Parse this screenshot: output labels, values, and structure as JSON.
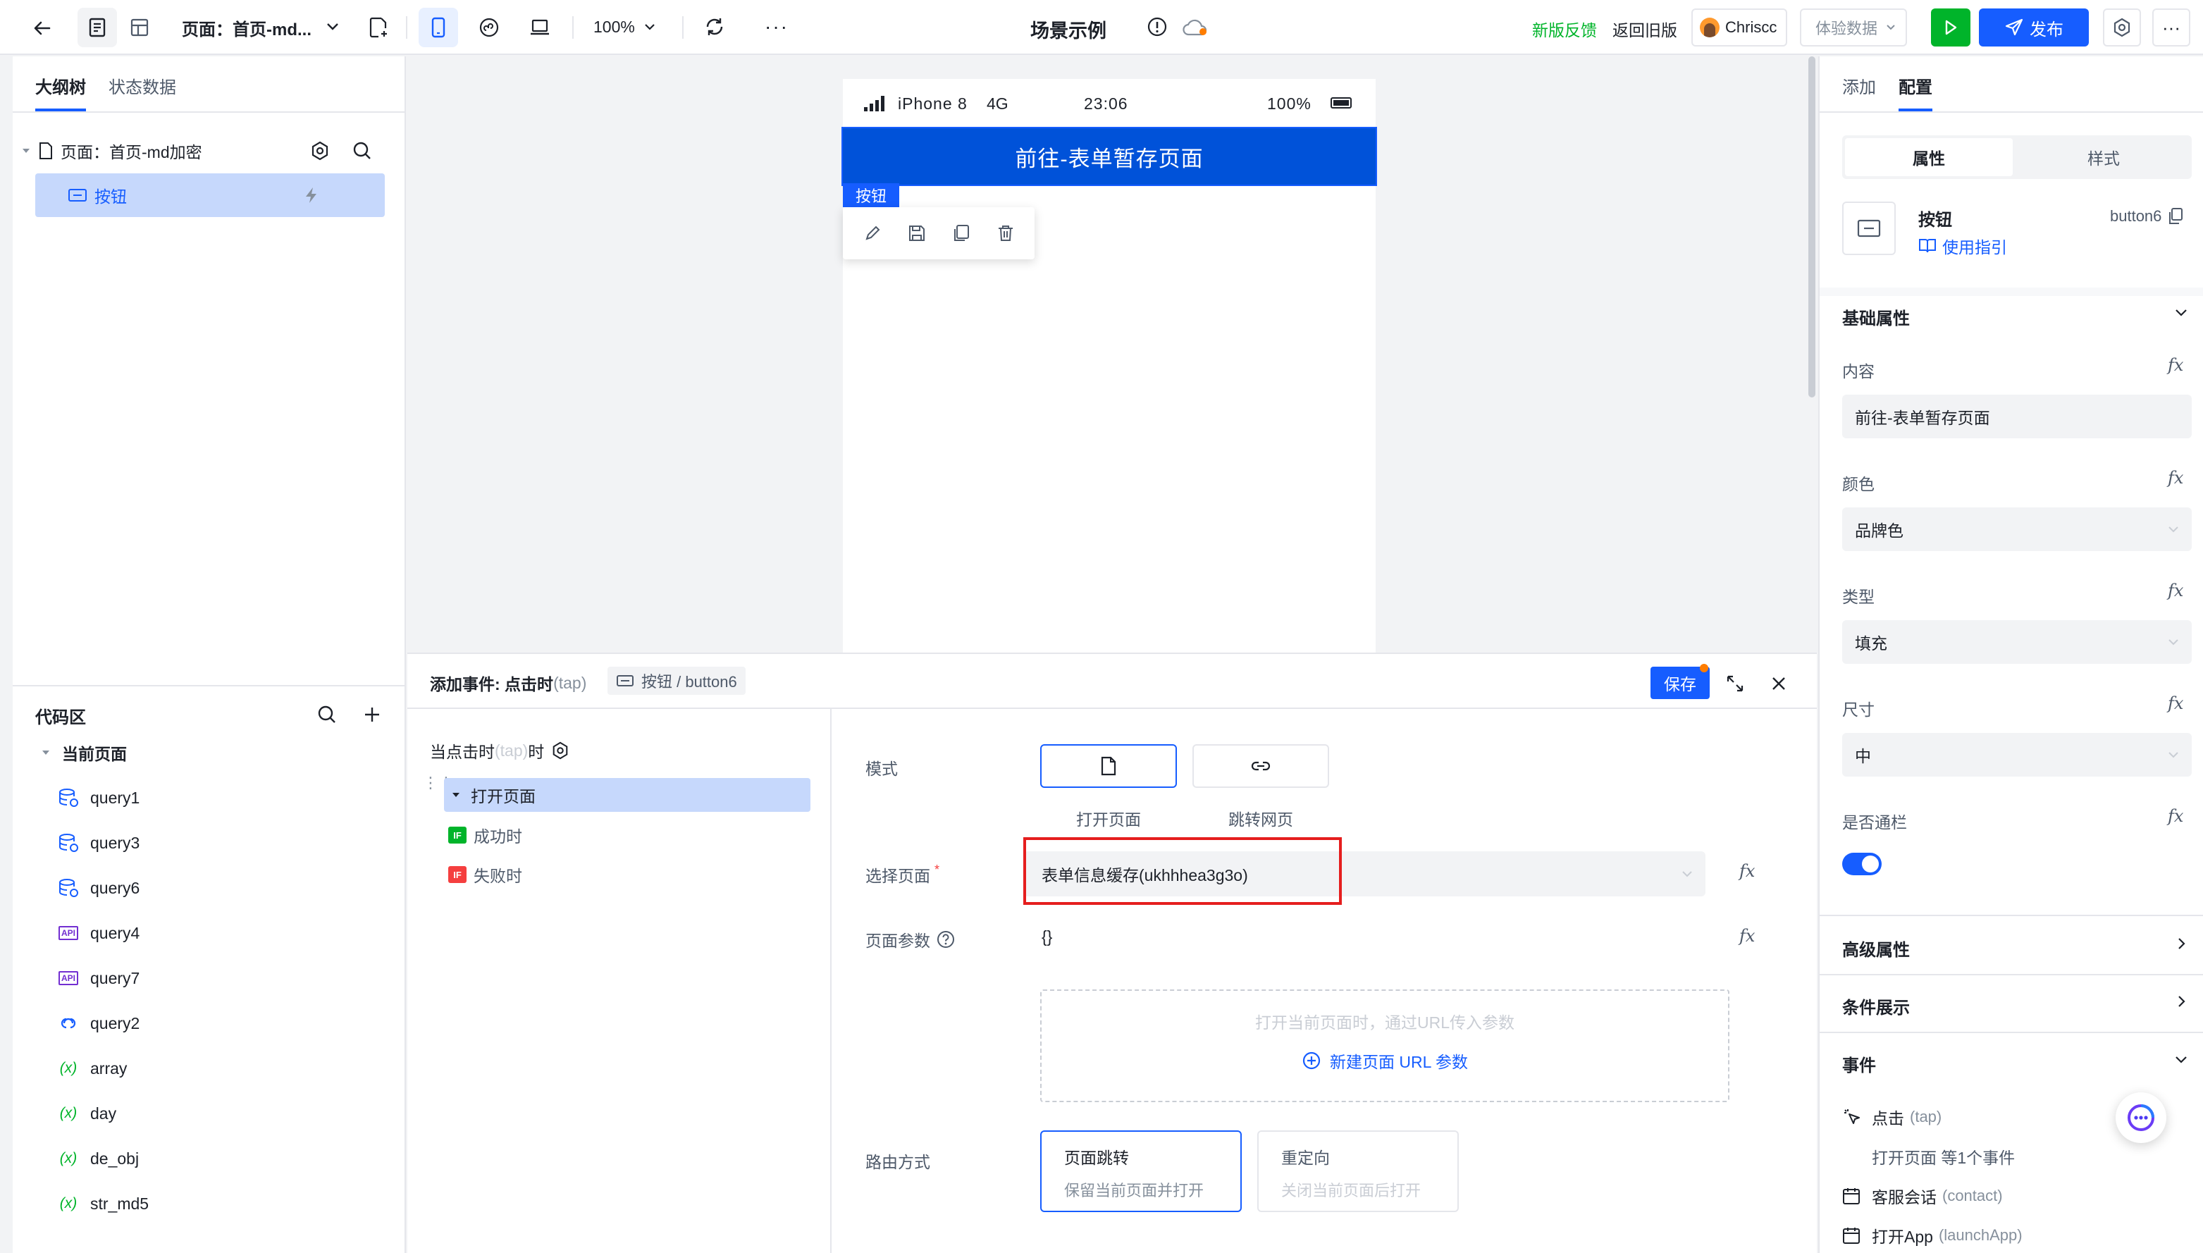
{
  "topbar": {
    "page_title": "页面：首页-md...",
    "zoom": "100%",
    "scene_title": "场景示例",
    "feedback": "新版反馈",
    "old_version": "返回旧版",
    "user": "Chriscc",
    "experience_data": "体验数据",
    "publish": "发布"
  },
  "left": {
    "tabs": [
      "大纲树",
      "状态数据"
    ],
    "tree_page": "页面：首页-md加密",
    "tree_button": "按钮",
    "code_title": "代码区",
    "current_page": "当前页面",
    "code_items": [
      {
        "name": "query1",
        "icon": "database-icon"
      },
      {
        "name": "query3",
        "icon": "database-icon"
      },
      {
        "name": "query6",
        "icon": "database-icon"
      },
      {
        "name": "query4",
        "icon": "api-icon"
      },
      {
        "name": "query7",
        "icon": "api-icon"
      },
      {
        "name": "query2",
        "icon": "link-icon"
      },
      {
        "name": "array",
        "icon": "variable-icon"
      },
      {
        "name": "day",
        "icon": "variable-icon"
      },
      {
        "name": "de_obj",
        "icon": "variable-icon"
      },
      {
        "name": "str_md5",
        "icon": "variable-icon"
      }
    ],
    "api_badge": "API",
    "var_badge": "(x)"
  },
  "phone": {
    "carrier": "iPhone 8",
    "network": "4G",
    "time": "23:06",
    "battery": "100%",
    "button_text": "前往-表单暂存页面",
    "tag": "按钮"
  },
  "event": {
    "title": "添加事件: 点击时",
    "title_tap": "(tap)",
    "crumb": "按钮 / button6",
    "save": "保存",
    "trigger_prefix": "当点击时",
    "trigger_tap": "(tap)",
    "trigger_suffix": "时",
    "action": "打开页面",
    "success_badge": "IF",
    "success": "成功时",
    "fail_badge": "IF",
    "fail": "失败时",
    "mode_label": "模式",
    "mode_open": "打开页面",
    "mode_jump": "跳转网页",
    "select_label": "选择页面",
    "required_mark": "*",
    "select_value": "表单信息缓存(ukhhhea3g3o)",
    "params_label": "页面参数",
    "params_value": "{}",
    "params_hint": "打开当前页面时，通过URL传入参数",
    "params_add": "新建页面 URL 参数",
    "route_label": "路由方式",
    "route1_title": "页面跳转",
    "route1_desc": "保留当前页面并打开",
    "route2_title": "重定向",
    "route2_desc": "关闭当前页面后打开"
  },
  "right": {
    "tabs": [
      "添加",
      "配置"
    ],
    "seg": [
      "属性",
      "样式"
    ],
    "comp_name": "按钮",
    "comp_id": "button6",
    "guide": "使用指引",
    "basic": "基础属性",
    "content_label": "内容",
    "content_value": "前往-表单暂存页面",
    "color_label": "颜色",
    "color_value": "品牌色",
    "type_label": "类型",
    "type_value": "填充",
    "size_label": "尺寸",
    "size_value": "中",
    "block_label": "是否通栏",
    "advanced": "高级属性",
    "condition": "条件展示",
    "events": "事件",
    "ev1": "点击",
    "ev1_tap": "(tap)",
    "ev1_desc": "打开页面 等1个事件",
    "ev2": "客服会话",
    "ev2_sub": "(contact)",
    "ev3": "打开App",
    "ev3_sub": "(launchApp)",
    "fx": "fx"
  },
  "colors": {
    "brand": "#165dff",
    "green": "#00b42a",
    "red": "#f53f3f"
  }
}
